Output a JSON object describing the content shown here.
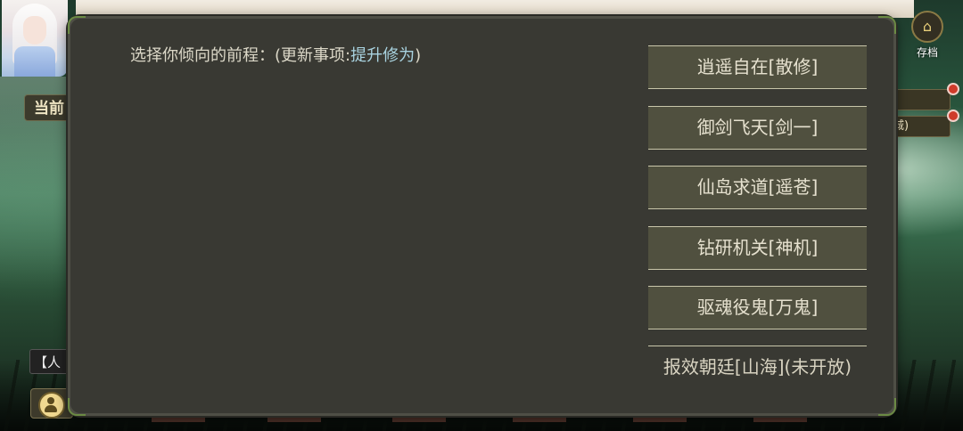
{
  "dialog": {
    "prompt_label": "选择你倾向的前程：(更新事项:",
    "prompt_highlight": "提升修为",
    "prompt_end": ")",
    "options": [
      {
        "label": "逍遥自在[散修]"
      },
      {
        "label": "御剑飞天[剑一]"
      },
      {
        "label": "仙岛求道[遥苍]"
      },
      {
        "label": "钻研机关[神机]"
      },
      {
        "label": "驱魂役鬼[万鬼]"
      },
      {
        "label": "报效朝廷[山海](未开放)"
      }
    ]
  },
  "hud": {
    "current_tag": "当前",
    "person_tag": "【人",
    "save_label": "存档",
    "save_icon": "save-icon",
    "side_pill_2": "城)"
  },
  "colors": {
    "dialog_bg": "#393933",
    "option_bg": "#50503f",
    "highlight_text": "#a9d3e0"
  }
}
